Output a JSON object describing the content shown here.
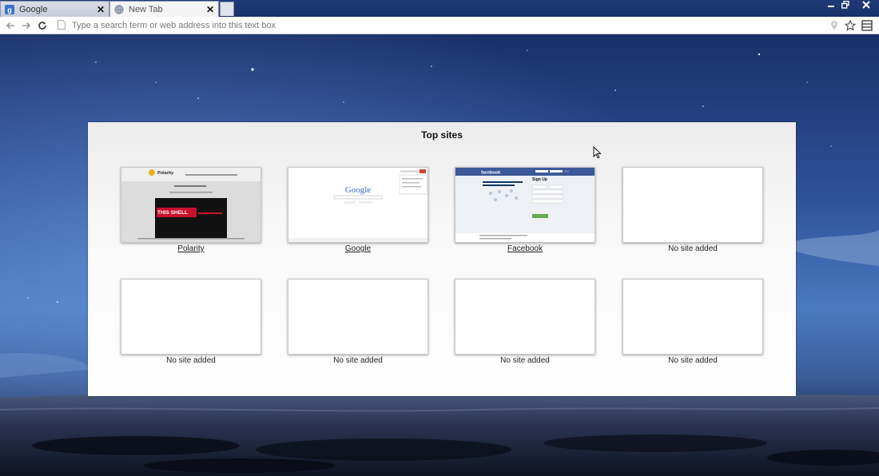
{
  "tabs": [
    {
      "title": "Google",
      "favicon": "google-g-icon",
      "active": false
    },
    {
      "title": "New Tab",
      "favicon": "globe-icon",
      "active": true
    }
  ],
  "toolbar": {
    "address_placeholder": "Type a search term or web address into this text box",
    "address_value": ""
  },
  "top_sites": {
    "title": "Top sites",
    "tiles": [
      {
        "label": "Polarity",
        "has_site": true,
        "thumbnail": "polarity-thumbnail"
      },
      {
        "label": "Google",
        "has_site": true,
        "thumbnail": "google-thumbnail"
      },
      {
        "label": "Facebook",
        "has_site": true,
        "thumbnail": "facebook-thumbnail"
      },
      {
        "label": "No site added",
        "has_site": false
      },
      {
        "label": "No site added",
        "has_site": false
      },
      {
        "label": "No site added",
        "has_site": false
      },
      {
        "label": "No site added",
        "has_site": false
      },
      {
        "label": "No site added",
        "has_site": false
      }
    ]
  },
  "thumbnails": {
    "polarity": {
      "brand": "Polarity",
      "banner": "THIS SHELL"
    },
    "google": {
      "logo": "Google"
    },
    "facebook": {
      "brand": "facebook",
      "heading": "Sign Up"
    }
  },
  "colors": {
    "titlebar": "#1f3a78",
    "sky_top": "#1d356b",
    "sky_mid": "#3d66b0",
    "sea": "#1a2238",
    "facebook_blue": "#3b5998"
  }
}
